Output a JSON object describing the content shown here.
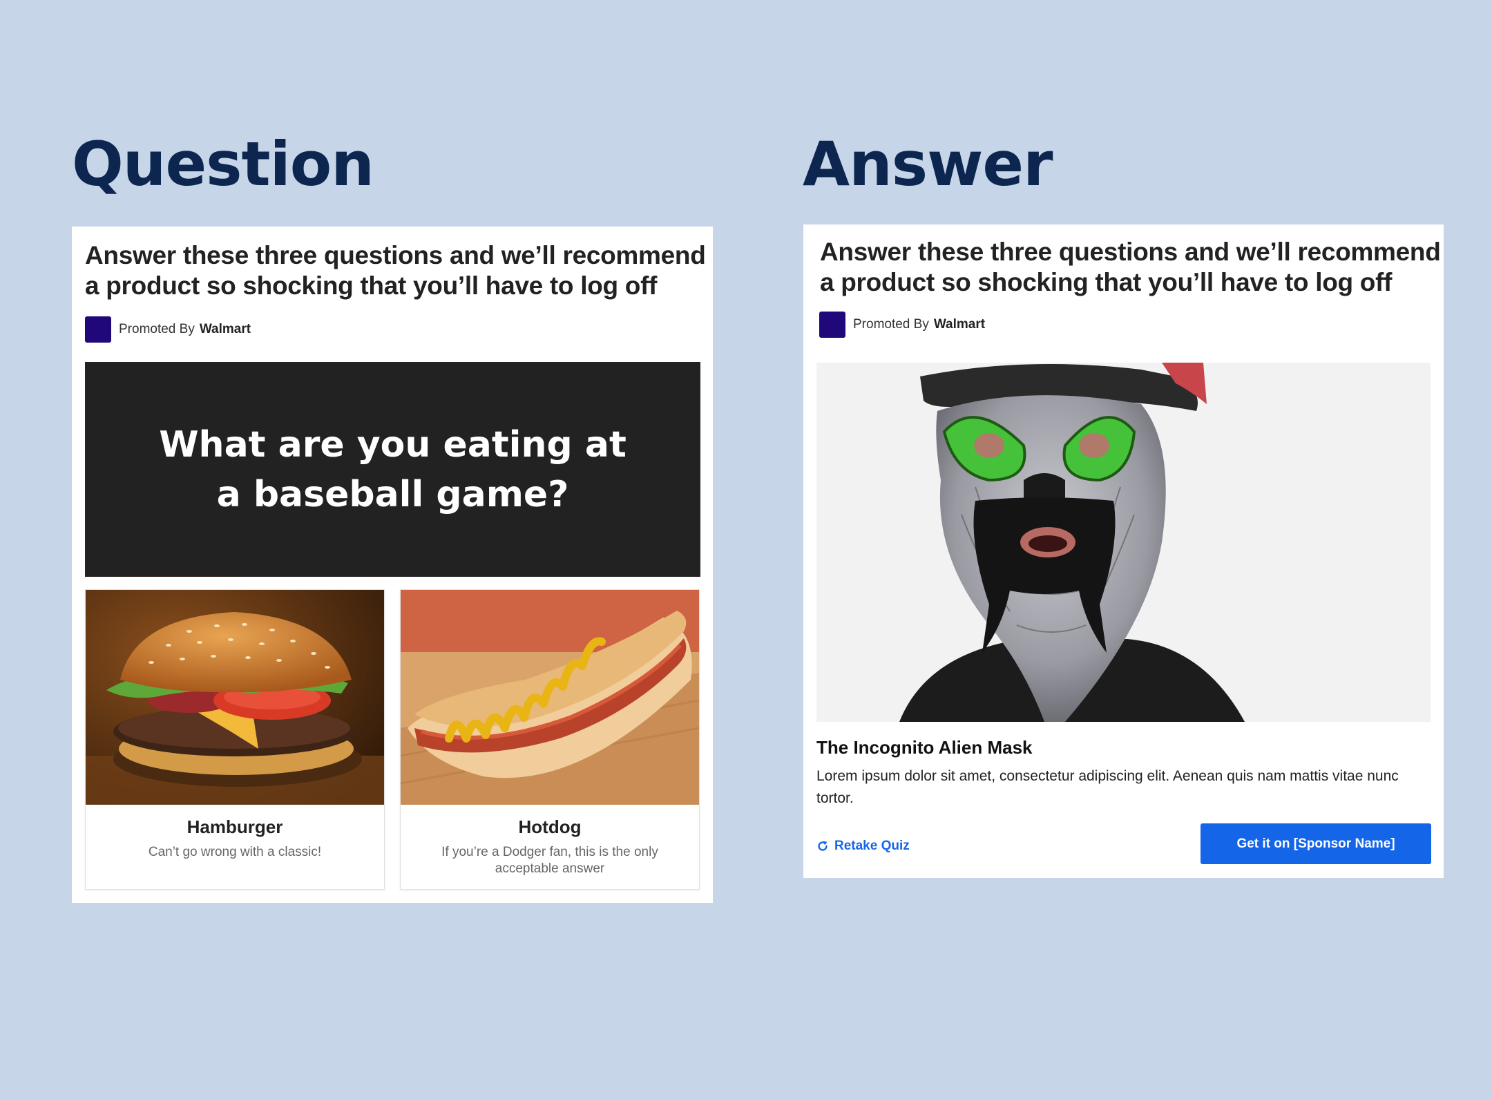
{
  "question_section": {
    "title": "Question",
    "headline": "Answer these three questions and we’ll recommend a product so shocking that you’ll have to log off",
    "promoted_by_label": "Promoted By",
    "sponsor": "Walmart",
    "question": "What are you eating at a baseball game?",
    "options": [
      {
        "label": "Hamburger",
        "description": "Can’t go wrong with a classic!"
      },
      {
        "label": "Hotdog",
        "description": "If you’re a Dodger fan, this is the only acceptable answer"
      }
    ]
  },
  "answer_section": {
    "title": "Answer",
    "headline": "Answer these three questions and we’ll recommend a product so shocking that you’ll have to log off",
    "promoted_by_label": "Promoted By",
    "sponsor": "Walmart",
    "product_name": "The Incognito Alien Mask",
    "product_description": "Lorem ipsum dolor sit amet, consectetur adipiscing elit. Aenean quis nam mattis vitae nunc tortor.",
    "retake_label": "Retake Quiz",
    "cta_label": "Get it on [Sponsor Name]"
  },
  "colors": {
    "page_background": "#c6d5e8",
    "title_navy": "#0c2650",
    "sponsor_logo": "#21087a",
    "accent_blue": "#1565e8",
    "question_banner": "#222222"
  },
  "icons": {
    "retake": "refresh-icon"
  }
}
